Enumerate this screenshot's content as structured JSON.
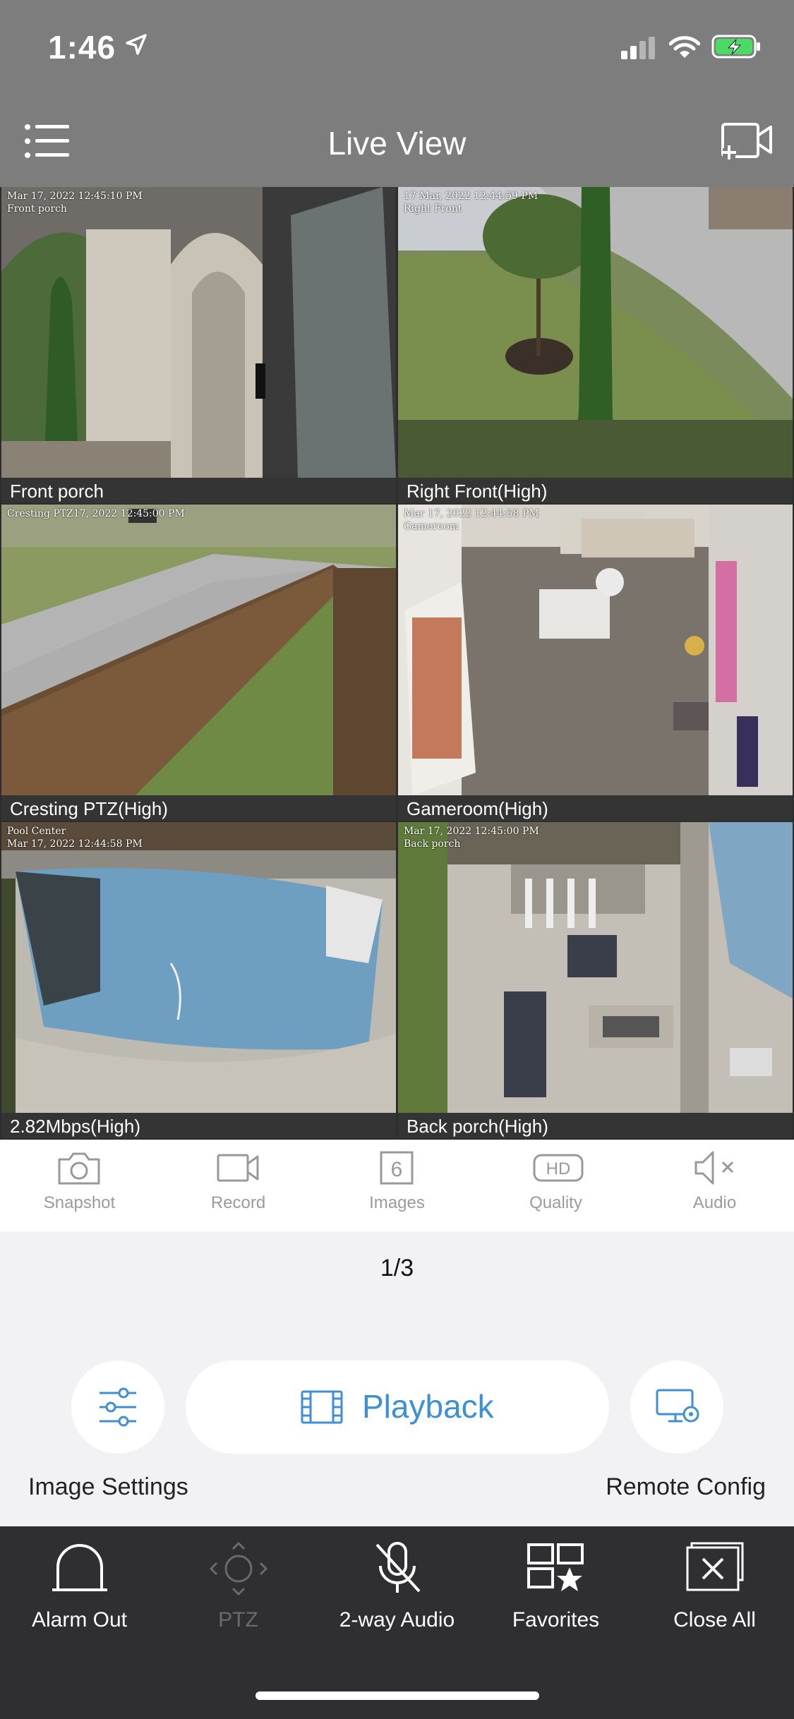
{
  "status_bar": {
    "time": "1:46"
  },
  "nav": {
    "title": "Live View"
  },
  "cameras": [
    {
      "label": "Front porch",
      "stamp": "Mar 17, 2022 12:45:10 PM\nFront porch"
    },
    {
      "label": "Right Front(High)",
      "stamp": "17 Mar, 2022 12:44:59 PM\nRight Front"
    },
    {
      "label": "Cresting PTZ(High)",
      "stamp": "Cresting PTZ17, 2022 12:45:00 PM"
    },
    {
      "label": "Gameroom(High)",
      "stamp": "Mar 17, 2022 12:44:58 PM\nGameroom"
    },
    {
      "label": "2.82Mbps(High)",
      "stamp": "Pool Center\nMar 17, 2022 12:44:58 PM"
    },
    {
      "label": "Back porch(High)",
      "stamp": "Mar 17, 2022 12:45:00 PM\nBack porch"
    }
  ],
  "toolbar": {
    "snapshot": "Snapshot",
    "record": "Record",
    "images": "Images",
    "images_count": "6",
    "quality": "Quality",
    "quality_badge": "HD",
    "audio": "Audio"
  },
  "pager": "1/3",
  "actions": {
    "playback": "Playback",
    "image_settings": "Image Settings",
    "remote_config": "Remote Config"
  },
  "bottom": {
    "alarm_out": "Alarm Out",
    "ptz": "PTZ",
    "two_way_audio": "2-way Audio",
    "favorites": "Favorites",
    "close_all": "Close All"
  },
  "colors": {
    "accent": "#3d8fd6",
    "selected_border": "#e7c766",
    "header_bg": "#7d7d7d",
    "bottom_bg": "#2f2f31"
  }
}
